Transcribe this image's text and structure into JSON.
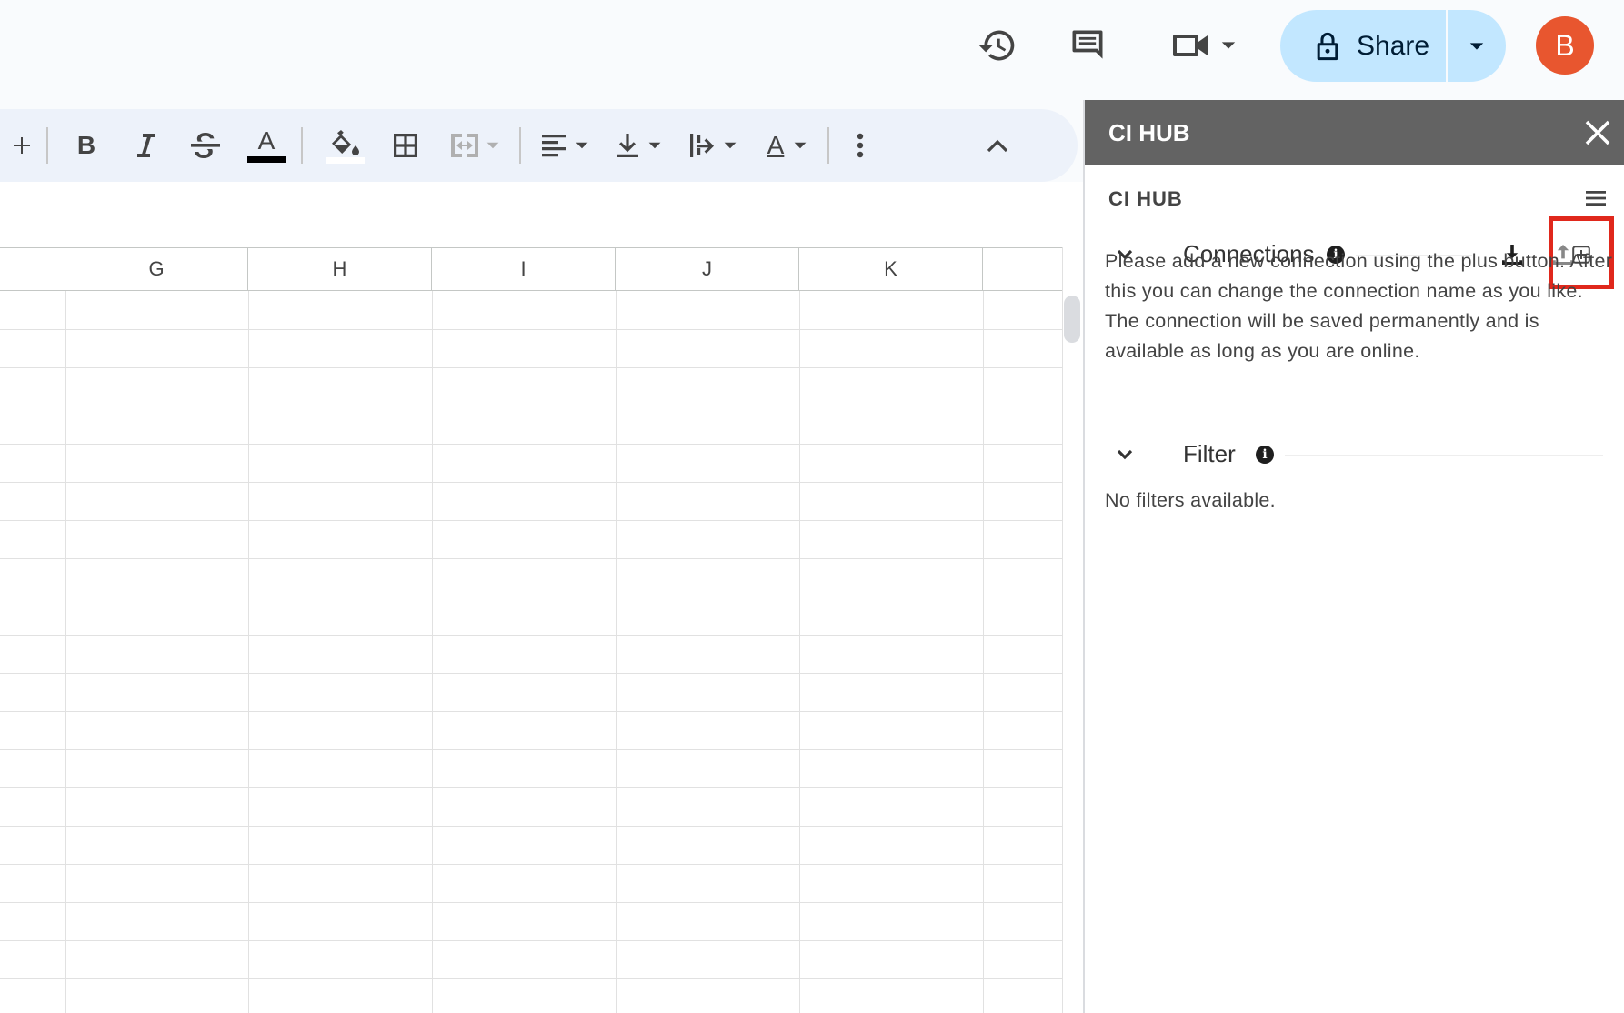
{
  "header": {
    "share_label": "Share",
    "avatar_letter": "B",
    "icons": [
      "version-history-icon",
      "comments-icon",
      "meet-video-icon",
      "share-dropdown-icon"
    ]
  },
  "toolbar": {
    "icons": [
      "insert-icon",
      "bold-icon",
      "italic-icon",
      "strikethrough-icon",
      "text-color-icon",
      "fill-color-icon",
      "borders-icon",
      "merge-cells-icon",
      "horizontal-align-icon",
      "vertical-align-icon",
      "text-wrap-icon",
      "text-rotation-icon",
      "more-icon",
      "collapse-menu-icon"
    ],
    "bold_label": "B",
    "text_color_label": "A",
    "rotation_label": "A"
  },
  "sheet": {
    "columns": [
      "G",
      "H",
      "I",
      "J",
      "K"
    ]
  },
  "panel": {
    "title": "CI HUB",
    "subtitle": "CI HUB",
    "connections": {
      "label": "Connections",
      "message": "Please add a new connection using the plus button. After this you can change the connection name as you like. The connection will be saved permanently and is available as long as you are online.",
      "action_icons": [
        "download-icon",
        "upload-icon",
        "add-connection-icon"
      ]
    },
    "filter": {
      "label": "Filter",
      "message": "No filters available."
    },
    "colors": {
      "header_bg": "#636363",
      "highlight": "#e0281c",
      "share_bg": "#c2e7ff",
      "avatar_bg": "#e8562f"
    }
  }
}
